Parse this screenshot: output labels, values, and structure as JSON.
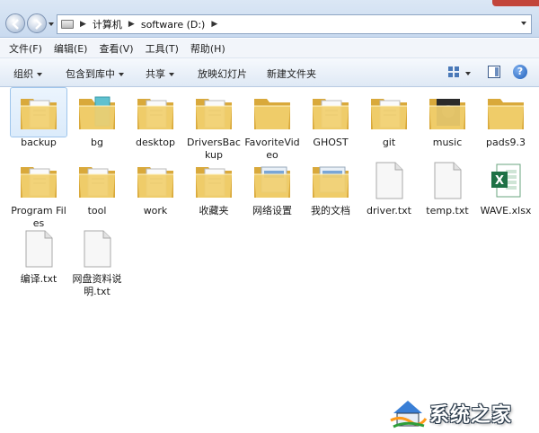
{
  "address": {
    "crumbs": [
      "计算机",
      "software (D:)"
    ]
  },
  "menu": [
    "文件(F)",
    "编辑(E)",
    "查看(V)",
    "工具(T)",
    "帮助(H)"
  ],
  "commands": {
    "organize": "组织",
    "include_library": "包含到库中",
    "share": "共享",
    "slideshow": "放映幻灯片",
    "new_folder": "新建文件夹"
  },
  "items": [
    {
      "label": "backup",
      "type": "folder"
    },
    {
      "label": "bg",
      "type": "folder"
    },
    {
      "label": "desktop",
      "type": "folder"
    },
    {
      "label": "DriversBackup",
      "type": "folder"
    },
    {
      "label": "FavoriteVideo",
      "type": "folder"
    },
    {
      "label": "GHOST",
      "type": "folder"
    },
    {
      "label": "git",
      "type": "folder"
    },
    {
      "label": "music",
      "type": "folder"
    },
    {
      "label": "pads9.3",
      "type": "folder"
    },
    {
      "label": "Program Files",
      "type": "folder"
    },
    {
      "label": "tool",
      "type": "folder"
    },
    {
      "label": "work",
      "type": "folder"
    },
    {
      "label": "收藏夹",
      "type": "folder"
    },
    {
      "label": "网络设置",
      "type": "folder"
    },
    {
      "label": "我的文档",
      "type": "folder"
    },
    {
      "label": "driver.txt",
      "type": "txt"
    },
    {
      "label": "temp.txt",
      "type": "txt"
    },
    {
      "label": "WAVE.xlsx",
      "type": "xlsx"
    },
    {
      "label": "编译.txt",
      "type": "txt"
    },
    {
      "label": "网盘资料说明.txt",
      "type": "txt"
    }
  ],
  "watermark": {
    "text": "系统之家"
  },
  "colors": {
    "folder": "#f1cf6e",
    "folder_dark": "#d9a93b",
    "accent": "#1f5fba",
    "excel": "#1e7145"
  }
}
